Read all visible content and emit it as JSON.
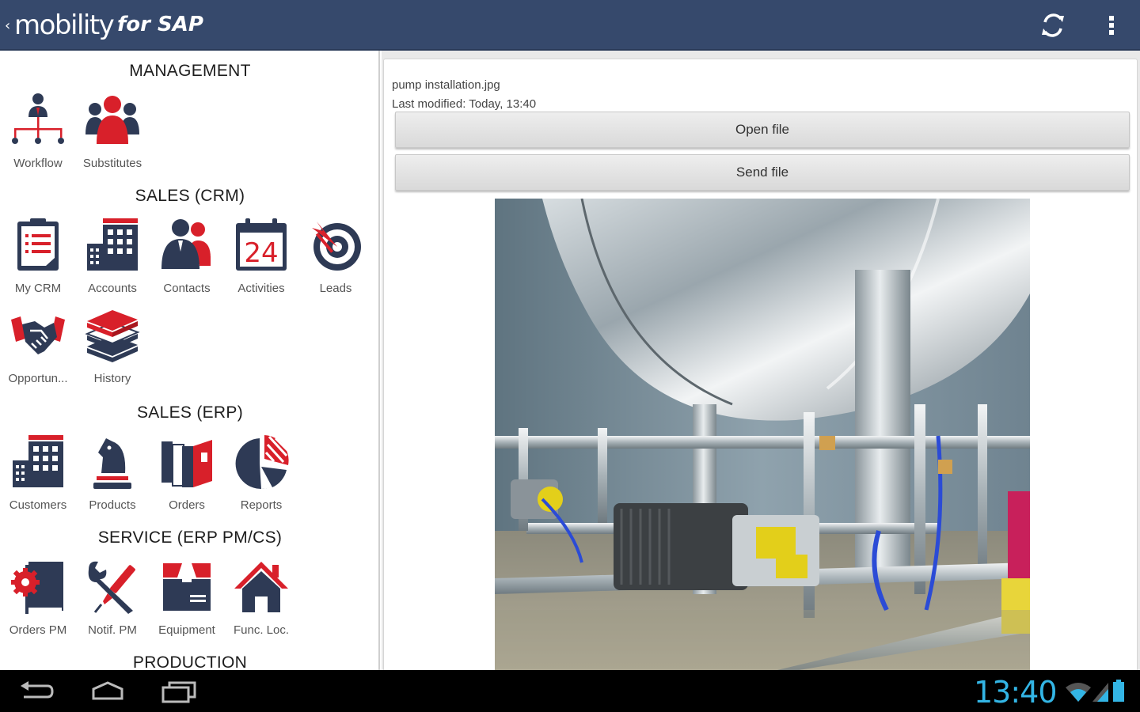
{
  "app": {
    "back_glyph": "‹",
    "brand": "mobility",
    "brand_sub": "for SAP"
  },
  "colors": {
    "actionbar": "#36496c",
    "navy": "#2e3a55",
    "red": "#d8202a",
    "clock": "#33b5e5"
  },
  "sections": {
    "management": "MANAGEMENT",
    "sales_crm": "SALES (CRM)",
    "sales_erp": "SALES (ERP)",
    "service": "SERVICE (ERP PM/CS)",
    "production": "PRODUCTION"
  },
  "tiles": {
    "workflow": {
      "label": "Workflow",
      "icon": "org-chart-icon"
    },
    "substitutes": {
      "label": "Substitutes",
      "icon": "people-icon"
    },
    "my_crm": {
      "label": "My CRM",
      "icon": "clipboard-icon"
    },
    "accounts": {
      "label": "Accounts",
      "icon": "building-icon"
    },
    "contacts": {
      "label": "Contacts",
      "icon": "contacts-icon"
    },
    "activities": {
      "label": "Activities",
      "icon": "calendar-icon",
      "day": "24"
    },
    "leads": {
      "label": "Leads",
      "icon": "target-icon"
    },
    "opportunities": {
      "label": "Opportun...",
      "icon": "handshake-icon"
    },
    "history": {
      "label": "History",
      "icon": "book-stack-icon"
    },
    "customers": {
      "label": "Customers",
      "icon": "building-icon"
    },
    "products": {
      "label": "Products",
      "icon": "chess-knight-icon"
    },
    "orders": {
      "label": "Orders",
      "icon": "binders-icon"
    },
    "reports": {
      "label": "Reports",
      "icon": "pie-chart-icon"
    },
    "orders_pm": {
      "label": "Orders PM",
      "icon": "gear-book-icon"
    },
    "notif_pm": {
      "label": "Notif. PM",
      "icon": "tools-icon"
    },
    "equipment": {
      "label": "Equipment",
      "icon": "box-icon"
    },
    "func_loc": {
      "label": "Func. Loc.",
      "icon": "house-icon"
    }
  },
  "file": {
    "name": "pump installation.jpg",
    "modified": "Last modified: Today, 13:40",
    "open_label": "Open file",
    "send_label": "Send file"
  },
  "status": {
    "time": "13:40"
  }
}
